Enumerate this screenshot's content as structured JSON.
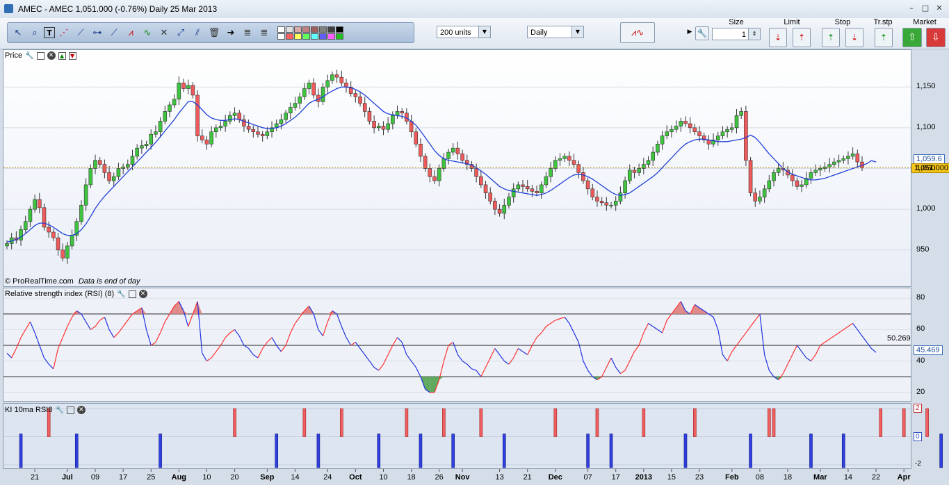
{
  "window": {
    "title": "AMEC - AMEC    1,051.000  (-0.76%)    Daily  25 Mar 2013"
  },
  "toolbar": {
    "units": "200 units",
    "period": "Daily",
    "order_headers": {
      "size": "Size",
      "limit": "Limit",
      "stop": "Stop",
      "trstp": "Tr.stp",
      "market": "Market"
    },
    "size_value": "1",
    "swatches": [
      "#ffffff",
      "#e0e0e0",
      "#d9a8a8",
      "#c08080",
      "#a06060",
      "#808080",
      "#404040",
      "#000000",
      "#ffffff",
      "#ff6060",
      "#ffff60",
      "#60ff60",
      "#60ffff",
      "#6060ff",
      "#ff60ff",
      "#20c020",
      "#ff0000",
      "#ffa020",
      "#ffff00",
      "#00c000",
      "#00c0c0",
      "#0000ff",
      "#c000c0",
      "#008000"
    ],
    "tools": [
      "cursor-icon",
      "zoom-icon",
      "text-icon",
      "fan-icon",
      "line-icon",
      "hline-icon",
      "trend-icon",
      "channel-icon",
      "wave-icon",
      "tools-icon",
      "arrows-icon",
      "parallel-icon",
      "trash-icon",
      "arrow-right-icon",
      "fib-icon",
      "fib2-icon"
    ]
  },
  "price_panel": {
    "label": "Price",
    "footer": "© ProRealTime.com",
    "footer_note": "Data is end of day",
    "last_price": "1,051.000",
    "ma_value": "1,059.6"
  },
  "rsi_panel": {
    "label": "Relative strength index (RSI) (8)",
    "value": "45.469",
    "marker": "50.269"
  },
  "ki_panel": {
    "label": "KI 10ma RSI8"
  },
  "chart_data": [
    {
      "type": "candlestick",
      "title": "Price",
      "ylim": [
        920,
        1180
      ],
      "yticks": [
        "1,150",
        "1,100",
        "1,050",
        "1,000",
        "950"
      ],
      "ytick_values": [
        1150,
        1100,
        1050,
        1000,
        950
      ],
      "x_labels": [
        "21",
        "Jul",
        "09",
        "17",
        "25",
        "Aug",
        "10",
        "20",
        "Sep",
        "14",
        "24",
        "Oct",
        "10",
        "18",
        "26",
        "Nov",
        "13",
        "21",
        "Dec",
        "07",
        "17",
        "2013",
        "15",
        "23",
        "Feb",
        "08",
        "18",
        "Mar",
        "14",
        "22",
        "Apr"
      ],
      "x_label_bold": [
        false,
        true,
        false,
        false,
        false,
        true,
        false,
        false,
        true,
        false,
        false,
        true,
        false,
        false,
        false,
        true,
        false,
        false,
        true,
        false,
        false,
        true,
        false,
        false,
        true,
        false,
        false,
        true,
        false,
        false,
        true
      ],
      "x_label_index": [
        6,
        13,
        19,
        25,
        31,
        37,
        43,
        49,
        56,
        62,
        69,
        75,
        81,
        87,
        93,
        98,
        106,
        112,
        118,
        125,
        131,
        137,
        143,
        149,
        156,
        162,
        168,
        175,
        181,
        187,
        193
      ],
      "closes": [
        958,
        965,
        962,
        975,
        985,
        1000,
        1012,
        1002,
        978,
        972,
        965,
        950,
        940,
        955,
        968,
        985,
        1005,
        1030,
        1050,
        1060,
        1055,
        1045,
        1035,
        1040,
        1050,
        1052,
        1055,
        1065,
        1075,
        1078,
        1080,
        1092,
        1095,
        1108,
        1120,
        1128,
        1135,
        1155,
        1148,
        1152,
        1140,
        1090,
        1085,
        1080,
        1095,
        1100,
        1102,
        1108,
        1115,
        1118,
        1110,
        1102,
        1098,
        1095,
        1092,
        1090,
        1095,
        1100,
        1105,
        1110,
        1118,
        1125,
        1130,
        1138,
        1148,
        1155,
        1140,
        1132,
        1150,
        1158,
        1165,
        1162,
        1155,
        1150,
        1142,
        1138,
        1130,
        1120,
        1108,
        1100,
        1102,
        1098,
        1105,
        1115,
        1120,
        1118,
        1108,
        1095,
        1080,
        1065,
        1050,
        1040,
        1035,
        1050,
        1062,
        1070,
        1075,
        1068,
        1060,
        1055,
        1050,
        1040,
        1030,
        1020,
        1010,
        1000,
        995,
        1005,
        1015,
        1025,
        1030,
        1028,
        1025,
        1022,
        1020,
        1030,
        1040,
        1050,
        1060,
        1062,
        1065,
        1060,
        1055,
        1045,
        1035,
        1025,
        1015,
        1010,
        1008,
        1005,
        1005,
        1010,
        1020,
        1035,
        1048,
        1045,
        1050,
        1055,
        1060,
        1070,
        1080,
        1090,
        1095,
        1098,
        1102,
        1108,
        1105,
        1100,
        1095,
        1090,
        1085,
        1080,
        1085,
        1090,
        1095,
        1098,
        1100,
        1115,
        1120,
        1060,
        1020,
        1010,
        1015,
        1025,
        1035,
        1045,
        1050,
        1048,
        1042,
        1035,
        1028,
        1030,
        1038,
        1045,
        1048,
        1050,
        1052,
        1055,
        1058,
        1060,
        1062,
        1065,
        1068,
        1058,
        1051
      ],
      "ma": [
        960,
        961,
        963,
        966,
        970,
        975,
        980,
        983,
        983,
        981,
        978,
        974,
        970,
        968,
        968,
        970,
        975,
        982,
        991,
        1001,
        1009,
        1016,
        1022,
        1028,
        1034,
        1040,
        1046,
        1052,
        1058,
        1064,
        1070,
        1076,
        1082,
        1089,
        1096,
        1103,
        1110,
        1118,
        1125,
        1132,
        1132,
        1128,
        1122,
        1116,
        1112,
        1110,
        1109,
        1109,
        1110,
        1111,
        1110,
        1108,
        1106,
        1104,
        1102,
        1100,
        1099,
        1099,
        1100,
        1102,
        1105,
        1109,
        1113,
        1118,
        1124,
        1130,
        1133,
        1135,
        1138,
        1142,
        1145,
        1148,
        1150,
        1150,
        1149,
        1147,
        1144,
        1140,
        1135,
        1130,
        1125,
        1120,
        1117,
        1116,
        1115,
        1114,
        1112,
        1108,
        1103,
        1096,
        1088,
        1080,
        1072,
        1066,
        1062,
        1060,
        1059,
        1058,
        1057,
        1056,
        1054,
        1051,
        1047,
        1043,
        1038,
        1033,
        1028,
        1025,
        1023,
        1022,
        1021,
        1020,
        1019,
        1018,
        1017,
        1018,
        1020,
        1023,
        1027,
        1031,
        1035,
        1039,
        1042,
        1043,
        1042,
        1040,
        1037,
        1033,
        1029,
        1025,
        1021,
        1018,
        1017,
        1018,
        1020,
        1024,
        1028,
        1032,
        1036,
        1040,
        1045,
        1051,
        1057,
        1063,
        1069,
        1075,
        1080,
        1083,
        1085,
        1086,
        1086,
        1085,
        1084,
        1083,
        1083,
        1083,
        1084,
        1085,
        1086,
        1088,
        1091,
        1088,
        1082,
        1075,
        1068,
        1062,
        1056,
        1050,
        1046,
        1043,
        1041,
        1039,
        1037,
        1036,
        1036,
        1037,
        1038,
        1040,
        1042,
        1044,
        1046,
        1048,
        1050,
        1052,
        1054,
        1056,
        1059.6,
        1058
      ]
    },
    {
      "type": "line",
      "title": "Relative strength index (RSI) (8)",
      "ylim": [
        15,
        85
      ],
      "yticks": [
        "80",
        "60",
        "40",
        "20"
      ],
      "ytick_values": [
        80,
        60,
        40,
        20
      ],
      "levels": [
        70,
        30,
        50
      ],
      "values": [
        45,
        42,
        48,
        55,
        60,
        65,
        58,
        50,
        42,
        38,
        35,
        48,
        55,
        62,
        68,
        72,
        70,
        65,
        60,
        62,
        66,
        68,
        60,
        55,
        58,
        62,
        66,
        70,
        72,
        74,
        60,
        50,
        52,
        58,
        65,
        70,
        75,
        78,
        72,
        62,
        70,
        78,
        45,
        40,
        42,
        46,
        50,
        55,
        58,
        60,
        56,
        50,
        48,
        44,
        42,
        48,
        52,
        55,
        50,
        46,
        50,
        58,
        64,
        68,
        72,
        75,
        70,
        60,
        56,
        65,
        72,
        70,
        62,
        55,
        50,
        52,
        48,
        44,
        40,
        36,
        34,
        38,
        44,
        50,
        55,
        52,
        44,
        40,
        36,
        30,
        22,
        20,
        20,
        28,
        40,
        50,
        52,
        44,
        40,
        38,
        35,
        34,
        30,
        36,
        42,
        48,
        44,
        40,
        38,
        42,
        48,
        46,
        44,
        50,
        55,
        58,
        62,
        64,
        66,
        67,
        68,
        64,
        58,
        52,
        40,
        34,
        30,
        28,
        30,
        36,
        42,
        36,
        32,
        34,
        40,
        46,
        50,
        58,
        64,
        62,
        60,
        58,
        66,
        70,
        74,
        78,
        72,
        70,
        76,
        74,
        72,
        70,
        68,
        60,
        44,
        40,
        46,
        50,
        54,
        58,
        62,
        66,
        70,
        44,
        34,
        30,
        28,
        32,
        38,
        44,
        50,
        46,
        42,
        40,
        44,
        50,
        52,
        54,
        56,
        58,
        60,
        62,
        64,
        60,
        56,
        52,
        48,
        45.469
      ],
      "last": 45.469
    },
    {
      "type": "bar",
      "title": "KI 10ma RSI8",
      "ylim": [
        -2.2,
        2.2
      ],
      "yticks": [
        "2",
        "0",
        "-2"
      ],
      "ytick_values": [
        2,
        0,
        -2
      ],
      "bars": [
        [
          3,
          -1
        ],
        [
          9,
          1
        ],
        [
          15,
          -1
        ],
        [
          33,
          -1
        ],
        [
          49,
          1
        ],
        [
          58,
          -1
        ],
        [
          64,
          1
        ],
        [
          67,
          -1
        ],
        [
          72,
          1
        ],
        [
          80,
          -1
        ],
        [
          86,
          1
        ],
        [
          89,
          -1
        ],
        [
          94,
          1
        ],
        [
          96,
          -1
        ],
        [
          102,
          1
        ],
        [
          107,
          -1
        ],
        [
          118,
          1
        ],
        [
          125,
          -1
        ],
        [
          127,
          1
        ],
        [
          130,
          -1
        ],
        [
          137,
          1
        ],
        [
          146,
          -1
        ],
        [
          148,
          1
        ],
        [
          160,
          -1
        ],
        [
          164,
          1
        ],
        [
          165,
          1
        ],
        [
          173,
          -1
        ],
        [
          180,
          -1
        ],
        [
          188,
          1
        ],
        [
          193,
          1
        ],
        [
          198,
          1
        ],
        [
          201,
          -1
        ]
      ]
    }
  ]
}
